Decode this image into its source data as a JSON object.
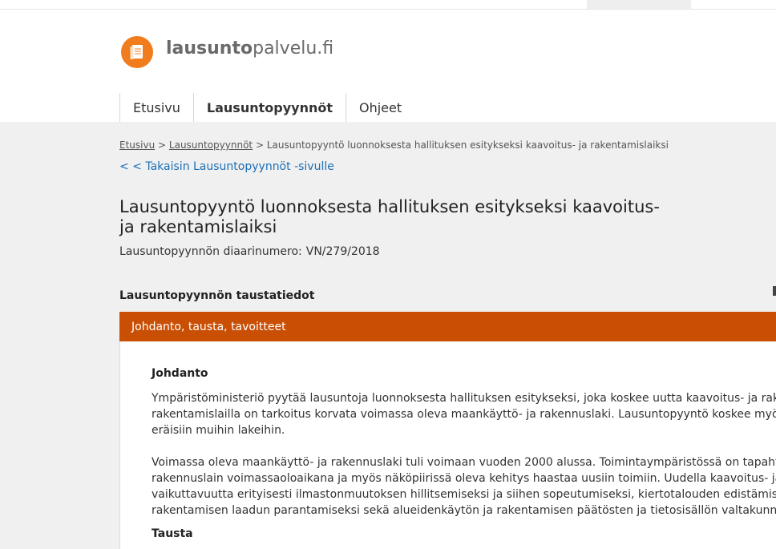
{
  "site": {
    "logo_bold": "lausunto",
    "logo_rest": "palvelu.fi"
  },
  "nav": [
    {
      "label": "Etusivu"
    },
    {
      "label": "Lausuntopyynnöt"
    },
    {
      "label": "Ohjeet"
    }
  ],
  "breadcrumb": {
    "home": "Etusivu",
    "separator": ">",
    "list": "Lausuntopyynnöt",
    "current": "Lausuntopyyntö luonnoksesta hallituksen esitykseksi kaavoitus- ja rakentamislaiksi"
  },
  "back_link": "< < Takaisin Lausuntopyynnöt -sivulle",
  "page": {
    "title_line1": "Lausuntopyyntö luonnoksesta hallituksen esitykseksi kaavoitus-",
    "title_line2": "ja rakentamislaiksi",
    "diary_label": "Lausuntopyynnön diaarinumero:",
    "diary_value": "VN/279/2018"
  },
  "background_section": {
    "heading": "Lausuntopyynnön taustatiedot",
    "panel_title": "Johdanto, tausta, tavoitteet",
    "intro_heading": "Johdanto",
    "paragraph1": [
      "Ympäristöministeriö pyytää lausuntoja luonnoksesta hallituksen esitykseksi, joka koskee uutta kaavoitus- ja rakentamislakia.",
      "rakentamislailla on tarkoitus korvata voimassa oleva maankäyttö- ja rakennuslaki. Lausuntopyyntö koskee myös saman",
      "eräisiin muihin lakeihin."
    ],
    "paragraph2": [
      "Voimassa oleva maankäyttö- ja rakennuslaki tuli voimaan vuoden 2000 alussa. Toimintaympäristössä on tapahtunut",
      "rakennuslain voimassaoloaikana ja myös näköpiirissä oleva kehitys haastaa uusiin toimiin. Uudella kaavoitus- ja rakentamislailla",
      "vaikuttavuutta erityisesti ilmastonmuutoksen hillitsemiseksi ja siihen sopeutumiseksi, kiertotalouden edistämiseksi",
      "rakentamisen laadun parantamiseksi sekä alueidenkäytön ja rakentamisen päätösten ja tietosisällön valtakunnallisen"
    ],
    "background_heading": "Tausta"
  }
}
